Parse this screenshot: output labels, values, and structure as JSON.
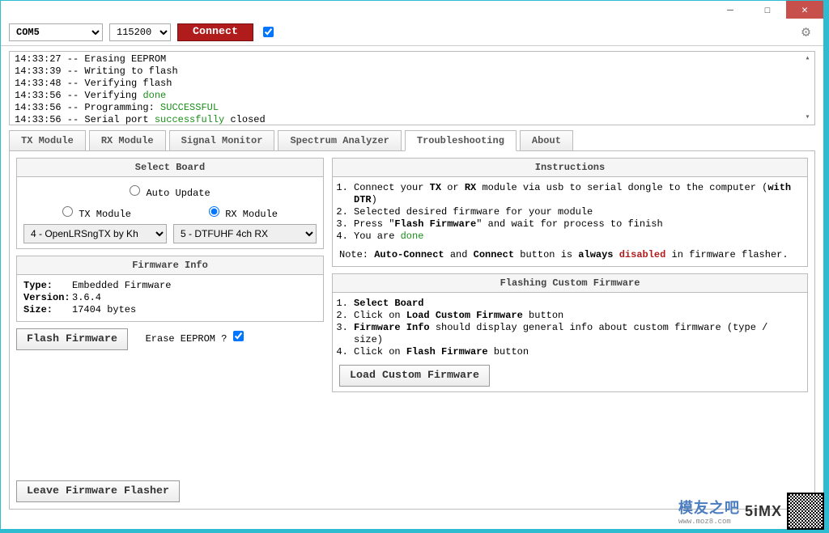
{
  "toolbar": {
    "port_selected": "COM5",
    "baud_selected": "115200",
    "connect_label": "Connect",
    "auto_connect_checked": true
  },
  "log_lines": [
    {
      "ts": "14:33:27",
      "msg": "Erasing EEPROM",
      "green": ""
    },
    {
      "ts": "14:33:39",
      "msg": "Writing to flash",
      "green": ""
    },
    {
      "ts": "14:33:48",
      "msg": "Verifying flash",
      "green": ""
    },
    {
      "ts": "14:33:56",
      "msg": "Verifying ",
      "green": "done"
    },
    {
      "ts": "14:33:56",
      "msg": "Programming: ",
      "green": "SUCCESSFUL"
    },
    {
      "ts": "14:33:56",
      "msg": "Serial port ",
      "green": "successfully",
      "tail": " closed"
    }
  ],
  "tabs": {
    "tx_module": "TX Module",
    "rx_module": "RX Module",
    "signal_monitor": "Signal Monitor",
    "spectrum_analyzer": "Spectrum Analyzer",
    "troubleshooting": "Troubleshooting",
    "about": "About"
  },
  "select_board": {
    "title": "Select Board",
    "auto_update": "Auto Update",
    "tx_module": "TX Module",
    "rx_module": "RX Module",
    "radio_selected": "rx",
    "tx_option": "4 - OpenLRSngTX by Kh",
    "rx_option": "5 - DTFUHF 4ch RX"
  },
  "firmware_info": {
    "title": "Firmware Info",
    "type_label": "Type:",
    "type_value": "Embedded Firmware",
    "version_label": "Version:",
    "version_value": "3.6.4",
    "size_label": "Size:",
    "size_value": "17404 bytes"
  },
  "flash_btn": "Flash Firmware",
  "erase_label": "Erase EEPROM ?",
  "erase_checked": true,
  "instructions": {
    "title": "Instructions",
    "step1_a": "Connect your ",
    "step1_b": "TX",
    "step1_c": " or ",
    "step1_d": "RX",
    "step1_e": " module via usb to serial dongle to the computer (",
    "step1_f": "with DTR",
    "step1_g": ")",
    "step2": "Selected desired firmware for your module",
    "step3_a": "Press \"",
    "step3_b": "Flash Firmware",
    "step3_c": "\" and wait for process to finish",
    "step4_a": "You are ",
    "step4_b": "done",
    "note_a": "Note: ",
    "note_b": "Auto-Connect",
    "note_c": " and ",
    "note_d": "Connect",
    "note_e": " button is ",
    "note_f": "always",
    "note_g": " ",
    "note_h": "disabled",
    "note_i": " in firmware flasher."
  },
  "custom_fw": {
    "title": "Flashing Custom Firmware",
    "s1": "Select Board",
    "s2_a": "Click on ",
    "s2_b": "Load Custom Firmware",
    "s2_c": " button",
    "s3_a": "Firmware Info",
    "s3_b": " should display general info about custom firmware (type / size)",
    "s4_a": "Click on ",
    "s4_b": "Flash Firmware",
    "s4_c": " button",
    "load_btn": "Load Custom Firmware"
  },
  "leave_btn": "Leave Firmware Flasher",
  "watermark": {
    "brand": "模友之吧",
    "url": "www.moz8.com",
    "tag": "5iMX"
  }
}
